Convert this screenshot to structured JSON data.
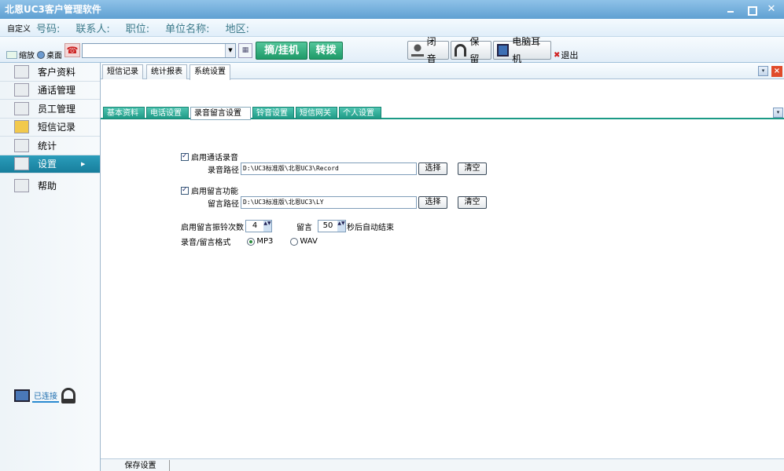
{
  "app": {
    "title": "北恩UC3客户管理软件",
    "close_glyph": "✕"
  },
  "infobar": {
    "custom": "自定义",
    "fields": [
      "号码:",
      "联系人:",
      "职位:",
      "单位名称:",
      "地区:"
    ]
  },
  "toolbar": {
    "shrink": "缩放",
    "desktop": "桌面",
    "phone_glyph": "☎",
    "grid_glyph": "▦",
    "dropdown_glyph": "▼",
    "pickup": "摘/挂机",
    "transfer": "转拨",
    "mute": "闭音",
    "hold": "保留",
    "pc_headset": "电脑耳机",
    "exit": "退出",
    "exit_glyph": "✖"
  },
  "sidebar": {
    "items": [
      {
        "label": "客户资料",
        "icon": "customer-icon"
      },
      {
        "label": "通话管理",
        "icon": "call-icon"
      },
      {
        "label": "员工管理",
        "icon": "staff-icon"
      },
      {
        "label": "短信记录",
        "icon": "sms-icon"
      },
      {
        "label": "统计",
        "icon": "stats-icon"
      },
      {
        "label": "设置",
        "icon": "settings-icon",
        "active": true
      },
      {
        "label": "帮助",
        "icon": "help-icon"
      }
    ],
    "arrow": "▶",
    "status": "已连接"
  },
  "tabs": {
    "items": [
      "短信记录",
      "统计报表",
      "系统设置"
    ],
    "active": 2,
    "chevron": "▾",
    "close": "×"
  },
  "subtabs": {
    "items": [
      "基本资料",
      "电话设置",
      "录音留言设置",
      "铃音设置",
      "短信网关",
      "个人设置"
    ],
    "active": 2
  },
  "settings": {
    "enable_recording": "启用通话录音",
    "record_path_label": "录音路径",
    "record_path": "D:\\UC3标准版\\北恩UC3\\Record",
    "enable_message": "启用留言功能",
    "message_path_label": "留言路径",
    "message_path": "D:\\UC3标准版\\北恩UC3\\LY",
    "select": "选择",
    "clear": "清空",
    "ring_count_label": "启用留言振铃次数",
    "ring_count": "4",
    "msg_label": "留言",
    "msg_seconds": "50",
    "msg_suffix": "秒后自动结束",
    "format_label": "录音/留言格式",
    "formats": [
      "MP3",
      "WAV"
    ],
    "format_selected": "MP3",
    "spin_glyph": "▲▼"
  },
  "footer": {
    "save": "保存设置"
  },
  "colors": {
    "title_bar": "#5fa0d2",
    "accent_green": "#1e9a68",
    "active_sidebar": "#177e9c",
    "subtab_teal": "#1e9a86"
  }
}
